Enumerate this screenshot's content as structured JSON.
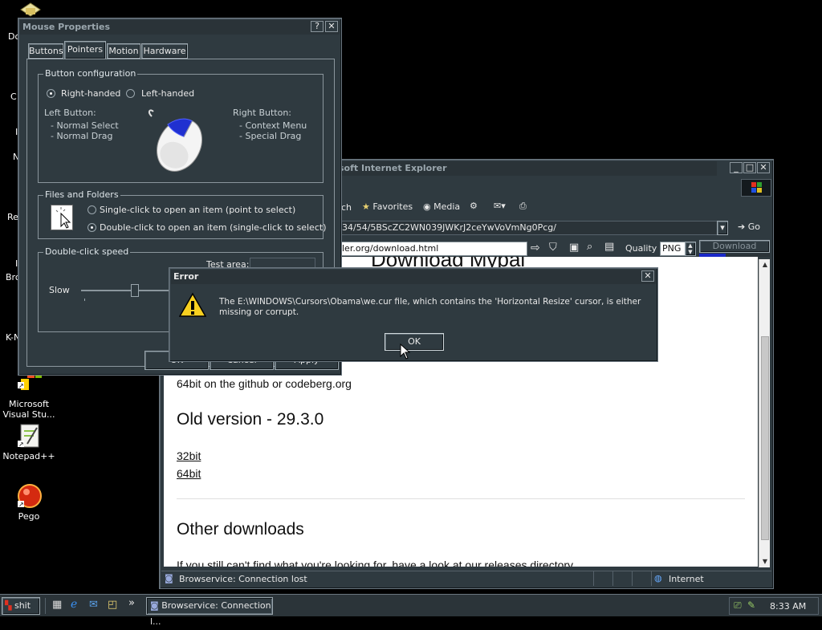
{
  "desktop": {
    "icons": [
      {
        "label": "Microsoft Visual Stu..."
      },
      {
        "label": "Notepad++"
      },
      {
        "label": "Pego"
      }
    ],
    "partial_labels": [
      "Do",
      "C",
      "I",
      "N",
      "Re",
      "I",
      "Bro",
      "K-N"
    ]
  },
  "mouse_properties": {
    "title": "Mouse Properties",
    "help": "?",
    "close": "✕",
    "tabs": [
      "Buttons",
      "Pointers",
      "Motion",
      "Hardware"
    ],
    "button_config": {
      "label": "Button configuration",
      "right_handed": "Right-handed",
      "left_handed": "Left-handed",
      "left_button": "Left Button:",
      "left_items": [
        "Normal Select",
        "Normal Drag"
      ],
      "right_button": "Right Button:",
      "right_items": [
        "Context Menu",
        "Special Drag"
      ]
    },
    "files_folders": {
      "label": "Files and Folders",
      "single": "Single-click to open an item (point to select)",
      "double": "Double-click to open an item (single-click to select)"
    },
    "dblclick": {
      "label": "Double-click speed",
      "slow": "Slow",
      "test_area": "Test area:"
    },
    "buttons": {
      "ok": "OK",
      "cancel": "Cancel",
      "apply": "Apply"
    }
  },
  "ie": {
    "title": "soft Internet Explorer",
    "toolbar": {
      "search": "ch",
      "favorites": "Favorites",
      "media": "Media"
    },
    "address": "34/54/5BScZC2WN039JWKrJ2ceYwVoVmNg0Pcg/",
    "go": "Go",
    "url2": "ler.org/download.html",
    "quality_label": "Quality",
    "quality_value": "PNG",
    "download_button": "Download",
    "download_progress": 0.38,
    "content": {
      "heading_partial": "Download Mypai",
      "line_64bit": "64bit on the github or codeberg.org",
      "old_version": "Old version - 29.3.0",
      "link_32": "32bit",
      "link_64": "64bit",
      "other_downloads": "Other downloads",
      "bottom_text": "If you still can't find what you're looking for, have a look at our releases directory"
    },
    "status": {
      "text": "Browservice: Connection lost",
      "zone": "Internet"
    }
  },
  "error_dialog": {
    "title": "Error",
    "close": "✕",
    "message": "The E:\\WINDOWS\\Cursors\\Obama\\we.cur file, which contains the 'Horizontal Resize' cursor, is either missing or corrupt.",
    "ok": "OK"
  },
  "taskbar": {
    "start": "shit",
    "chevron": "»",
    "task_label": "Browservice: Connection l...",
    "clock": "8:33 AM"
  },
  "colors": {
    "window_bg": "#2f3a40",
    "taskbar_bg": "#2b3439",
    "progress": "#1a28c8"
  }
}
